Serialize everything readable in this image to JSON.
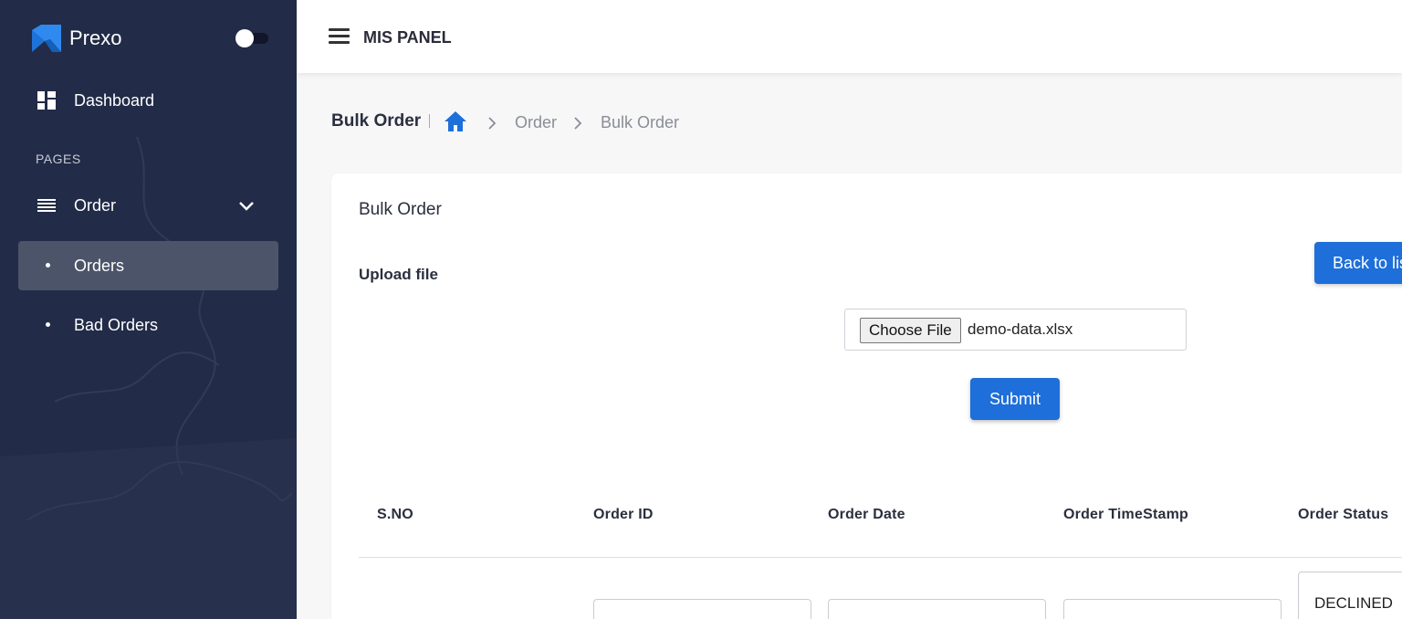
{
  "brand": {
    "name": "Prexo"
  },
  "sidebar": {
    "dashboard_label": "Dashboard",
    "section_label": "PAGES",
    "order_label": "Order",
    "sub_items": [
      {
        "label": "Orders",
        "active": true
      },
      {
        "label": "Bad Orders",
        "active": false
      }
    ]
  },
  "topbar": {
    "title": "MIS PANEL"
  },
  "breadcrumb": {
    "title": "Bulk Order",
    "items": [
      "Order",
      "Bulk Order"
    ]
  },
  "card": {
    "title": "Bulk Order",
    "upload_label": "Upload file",
    "back_button": "Back to list",
    "choose_file_label": "Choose File",
    "file_name": "demo-data.xlsx",
    "submit_label": "Submit"
  },
  "table": {
    "headers": [
      "S.NO",
      "Order ID",
      "Order Date",
      "Order TimeStamp",
      "Order Status"
    ],
    "first_row_status": "DECLINED"
  },
  "colors": {
    "sidebar_bg": "#222b47",
    "accent": "#1e6fd9"
  }
}
